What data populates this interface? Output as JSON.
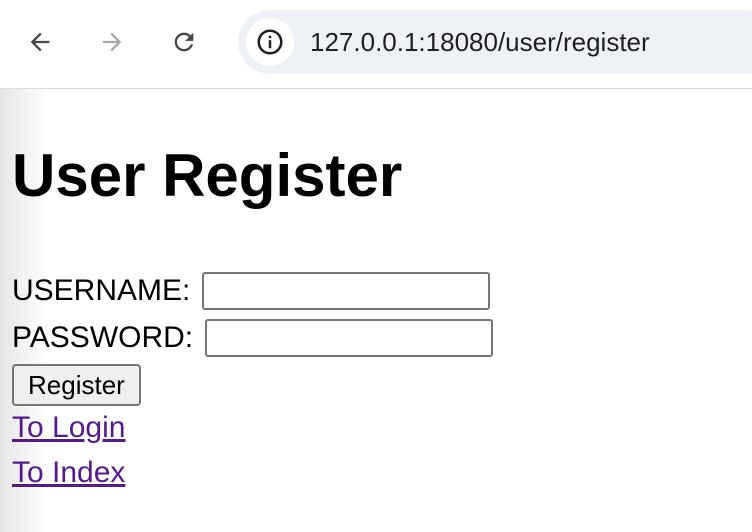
{
  "browser": {
    "url": "127.0.0.1:18080/user/register",
    "icons": {
      "back": "arrow-left-icon",
      "forward": "arrow-right-icon",
      "reload": "reload-icon",
      "site_info": "info-circle-icon"
    }
  },
  "page": {
    "title": "User Register",
    "form": {
      "username_label": "USERNAME:",
      "username_value": "",
      "password_label": "PASSWORD:",
      "password_value": "",
      "submit_label": "Register"
    },
    "links": [
      {
        "label": "To Login"
      },
      {
        "label": "To Index"
      }
    ]
  },
  "colors": {
    "link_visited": "#551a8b",
    "omnibox_bg": "#eef1f6",
    "button_bg": "#efefef"
  }
}
